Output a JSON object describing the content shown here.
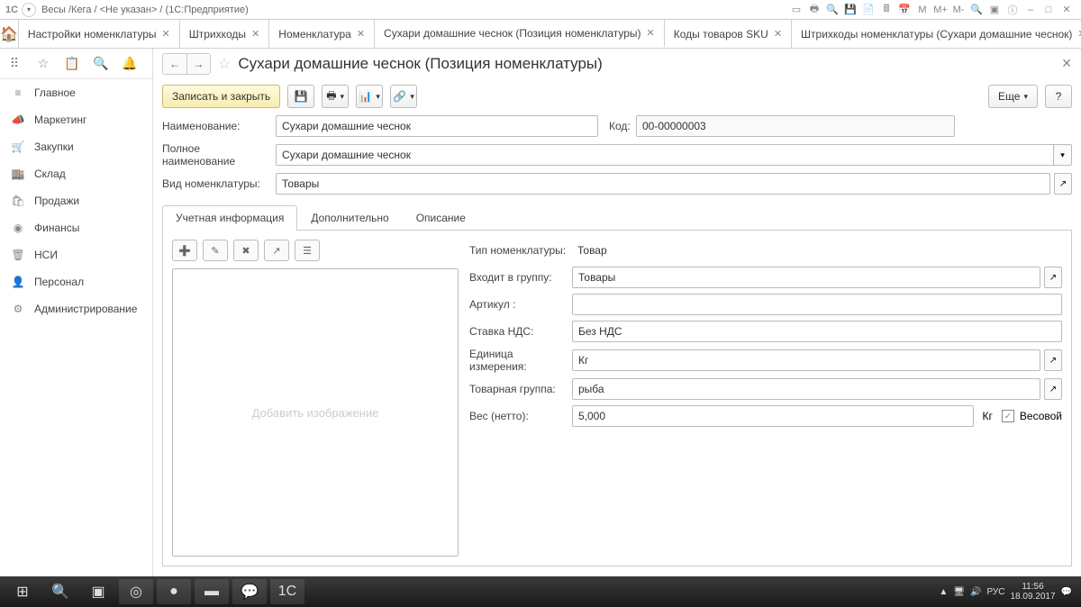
{
  "titlebar": {
    "app": "1С",
    "path": "Весы /Кега / <Не указан> /  (1С:Предприятие)"
  },
  "tabs": [
    {
      "label": "Настройки номенклатуры"
    },
    {
      "label": "Штрихкоды"
    },
    {
      "label": "Номенклатура"
    },
    {
      "label": "Сухари домашние чеснок (Позиция номенклатуры)",
      "active": true
    },
    {
      "label": "Коды товаров SKU"
    },
    {
      "label": "Штрихкоды номенклатуры (Сухари домашние чеснок)"
    }
  ],
  "sidebar": [
    {
      "icon": "≡",
      "label": "Главное"
    },
    {
      "icon": "📣",
      "label": "Маркетинг"
    },
    {
      "icon": "🛒",
      "label": "Закупки"
    },
    {
      "icon": "🏬",
      "label": "Склад"
    },
    {
      "icon": "🛍",
      "label": "Продажи"
    },
    {
      "icon": "◉",
      "label": "Финансы"
    },
    {
      "icon": "🗑",
      "label": "НСИ"
    },
    {
      "icon": "👤",
      "label": "Персонал"
    },
    {
      "icon": "⚙",
      "label": "Администрирование"
    }
  ],
  "page": {
    "title": "Сухари домашние чеснок (Позиция номенклатуры)",
    "save_close": "Записать и закрыть",
    "more": "Еще",
    "help": "?",
    "labels": {
      "name": "Наименование:",
      "code": "Код:",
      "fullname": "Полное наименование",
      "kind": "Вид номенклатуры:"
    },
    "values": {
      "name": "Сухари домашние чеснок",
      "code": "00-00000003",
      "fullname": "Сухари домашние чеснок",
      "kind": "Товары"
    },
    "inner_tabs": [
      "Учетная информация",
      "Дополнительно",
      "Описание"
    ],
    "img_placeholder": "Добавить изображение",
    "props": {
      "type_l": "Тип номенклатуры:",
      "type_v": "Товар",
      "group_l": "Входит в группу:",
      "group_v": "Товары",
      "art_l": "Артикул :",
      "art_v": "",
      "vat_l": "Ставка НДС:",
      "vat_v": "Без НДС",
      "unit_l": "Единица измерения:",
      "unit_v": "Кг",
      "tgroup_l": "Товарная группа:",
      "tgroup_v": "рыба",
      "weight_l": "Вес (нетто):",
      "weight_v": "5,000",
      "weight_u": "Кг",
      "weight_chk": "Весовой"
    }
  },
  "tray": {
    "lang": "РУС",
    "time": "11:56",
    "date": "18.09.2017"
  }
}
